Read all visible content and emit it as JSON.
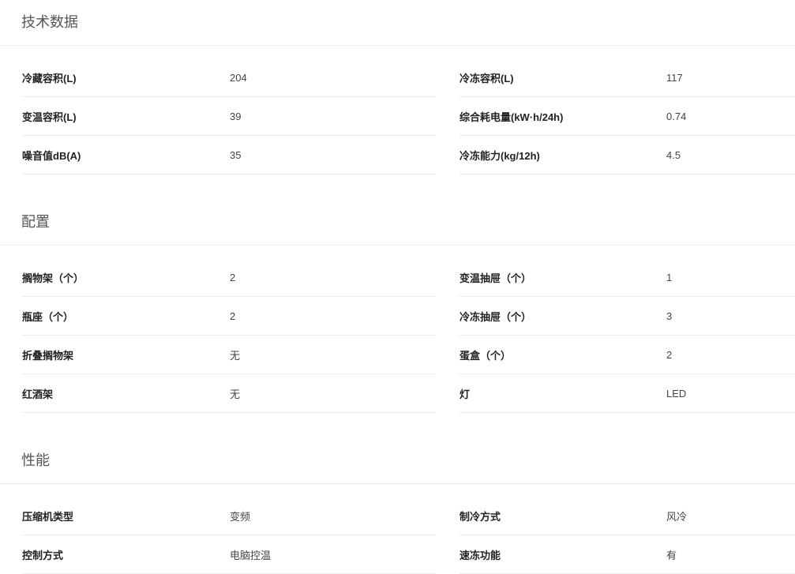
{
  "sections": [
    {
      "title": "技术数据",
      "rows": [
        [
          {
            "label": "冷藏容积(L)",
            "value": "204"
          },
          {
            "label": "冷冻容积(L)",
            "value": "117"
          }
        ],
        [
          {
            "label": "变温容积(L)",
            "value": "39"
          },
          {
            "label": "综合耗电量(kW·h/24h)",
            "value": "0.74"
          }
        ],
        [
          {
            "label": "噪音值dB(A)",
            "value": "35"
          },
          {
            "label": "冷冻能力(kg/12h)",
            "value": "4.5"
          }
        ]
      ]
    },
    {
      "title": "配置",
      "rows": [
        [
          {
            "label": "搁物架（个）",
            "value": "2"
          },
          {
            "label": "变温抽屉（个）",
            "value": "1"
          }
        ],
        [
          {
            "label": "瓶座（个）",
            "value": "2"
          },
          {
            "label": "冷冻抽屉（个）",
            "value": "3"
          }
        ],
        [
          {
            "label": "折叠搁物架",
            "value": "无"
          },
          {
            "label": "蛋盒（个）",
            "value": "2"
          }
        ],
        [
          {
            "label": "红酒架",
            "value": "无"
          },
          {
            "label": "灯",
            "value": "LED"
          }
        ]
      ]
    },
    {
      "title": "性能",
      "rows": [
        [
          {
            "label": "压缩机类型",
            "value": "变频"
          },
          {
            "label": "制冷方式",
            "value": "风冷"
          }
        ],
        [
          {
            "label": "控制方式",
            "value": "电脑控温"
          },
          {
            "label": "速冻功能",
            "value": "有"
          }
        ]
      ]
    }
  ]
}
